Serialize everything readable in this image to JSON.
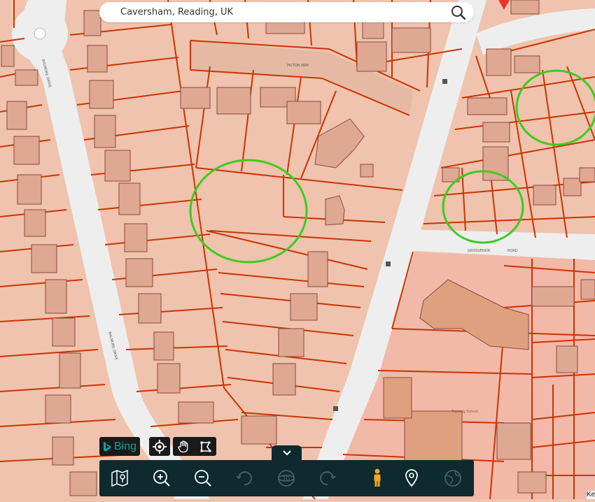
{
  "search": {
    "value": "Caversham, Reading, UK"
  },
  "map": {
    "street_labels": [
      "PICTON WAY",
      "BALMORE DRIVE",
      "BALMORE DRIVE",
      "GROSVENOR",
      "ROAD"
    ],
    "landmark_label": "Training School",
    "highlight_color": "#3ccc1e",
    "boundary_color": "#cc3300",
    "parcel_fill": "#efc3ad",
    "road_fill": "#eeeeee"
  },
  "bing": {
    "label": "Bing"
  },
  "key_tag": "Ke"
}
